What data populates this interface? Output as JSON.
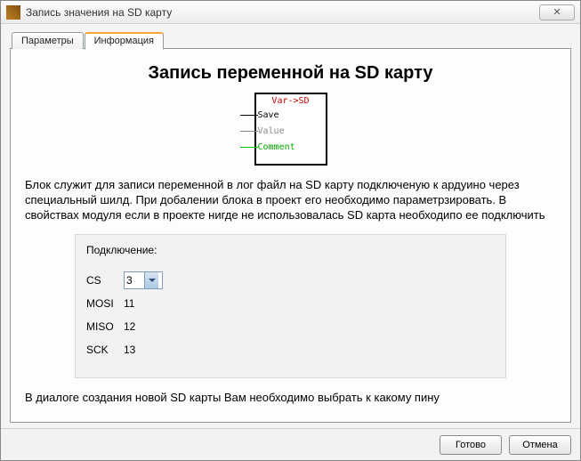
{
  "window": {
    "title": "Запись значения на SD карту",
    "close_symbol": "✕"
  },
  "tabs": {
    "parameters": "Параметры",
    "information": "Информация"
  },
  "page": {
    "heading": "Запись переменной на SD карту",
    "block": {
      "label": "Var->SD",
      "pin1": "Save",
      "pin2": "Value",
      "pin3": "Comment"
    },
    "description": "Блок служит для записи переменной в лог файл на SD карту подключеную к ардуино через специальный шилд. При добалении блока в проект его необходимо параметрзировать. В свойствах модуля если в проекте нигде не использовалась SD карта необходипо ее подключить",
    "panel": {
      "title": "Подключение:",
      "rows": {
        "cs_label": "CS",
        "cs_value": "3",
        "mosi_label": "MOSI",
        "mosi_value": "11",
        "miso_label": "MISO",
        "miso_value": "12",
        "sck_label": "SCK",
        "sck_value": "13"
      }
    },
    "description2": "В диалоге создания новой SD карты Вам необходимо выбрать к какому пину"
  },
  "buttons": {
    "ok": "Готово",
    "cancel": "Отмена"
  }
}
